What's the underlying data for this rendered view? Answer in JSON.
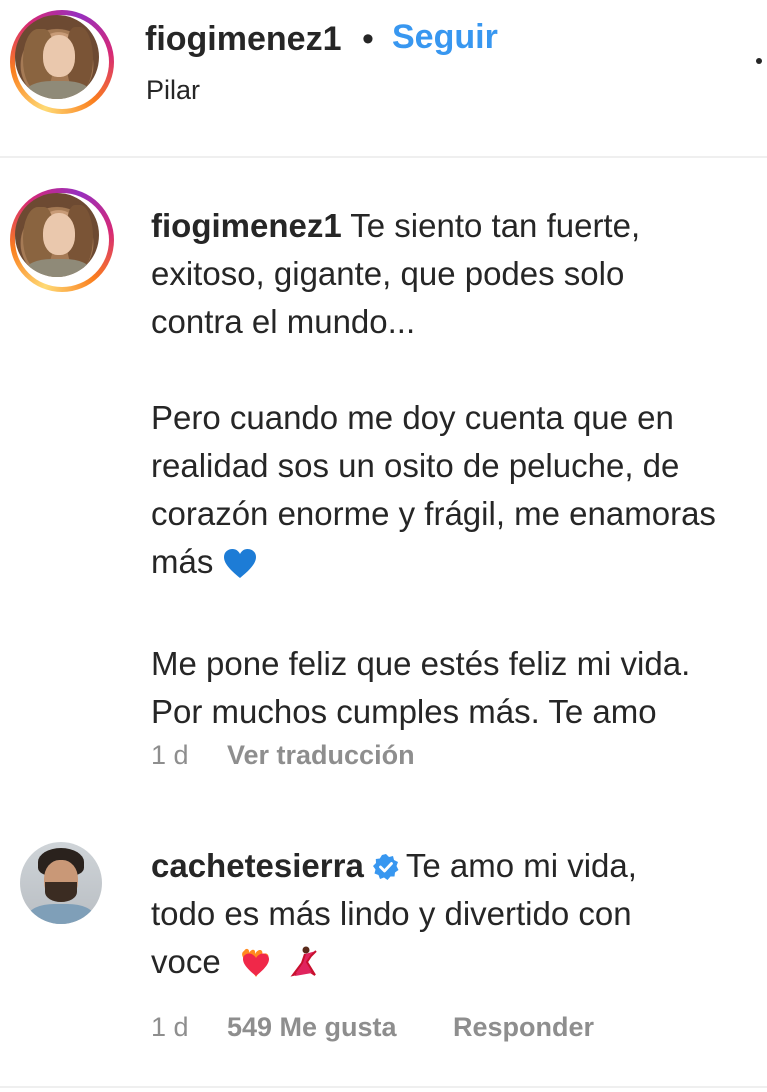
{
  "header": {
    "username": "fiogimenez1",
    "separator": "•",
    "follow_label": "Seguir",
    "location": "Pilar"
  },
  "comments": [
    {
      "username": "fiogimenez1",
      "text_lines": [
        "Te siento tan fuerte,",
        "exitoso, gigante, que podes solo",
        "contra el mundo..."
      ],
      "paragraph2_lines": [
        "Pero cuando me doy cuenta que en",
        "realidad sos un osito de peluche, de",
        "corazón enorme y frágil, me enamoras",
        "más"
      ],
      "paragraph3_lines": [
        "Me pone feliz que estés feliz mi vida.",
        "Por muchos cumples más. Te amo"
      ],
      "emoji": "blue-heart",
      "time": "1 d",
      "translate_label": "Ver traducción"
    },
    {
      "username": "cachetesierra",
      "verified": true,
      "text_line1": "Te amo mi vida,",
      "text_line2": "todo es más lindo y divertido con",
      "text_line3": "voce",
      "emojis": [
        "heart-on-fire",
        "dancer"
      ],
      "time": "1 d",
      "likes_label": "549 Me gusta",
      "reply_label": "Responder"
    }
  ],
  "colors": {
    "link_blue": "#3897f0",
    "text": "#262626",
    "muted": "#8e8e8e",
    "verified_blue": "#3897f0"
  }
}
